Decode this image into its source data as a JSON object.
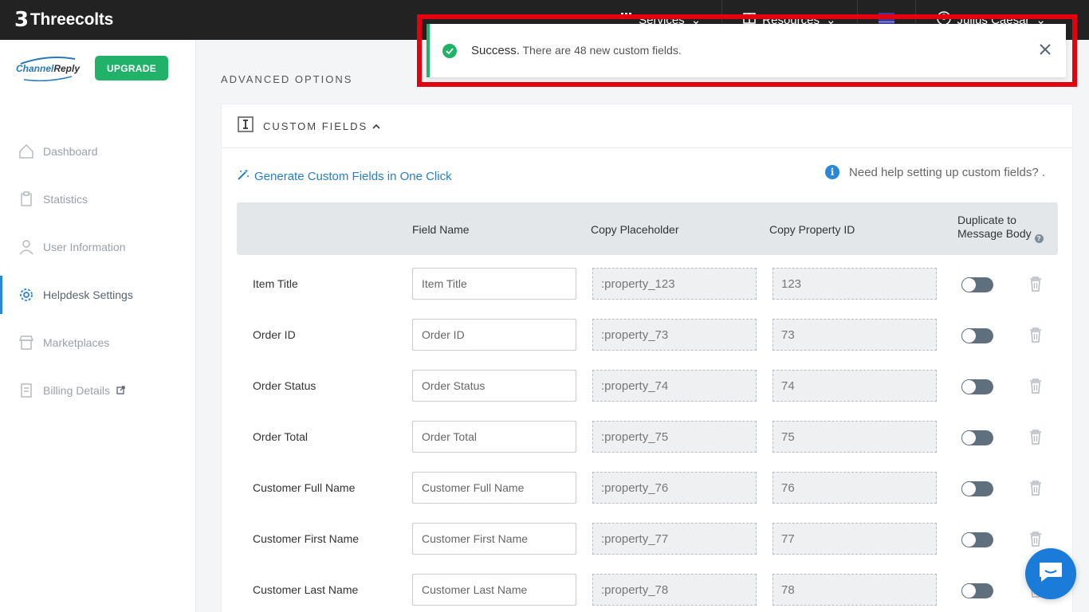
{
  "topbar": {
    "brand": "Threecolts",
    "nav": [
      {
        "label": "Services",
        "icon": "grid-icon"
      },
      {
        "label": "Resources",
        "icon": "book-icon"
      },
      {
        "label": "",
        "icon": "flag-icon"
      },
      {
        "label": "Julius Caesar",
        "icon": "user-icon"
      }
    ]
  },
  "sidebar": {
    "logo_text_a": "Channel",
    "logo_text_b": "Reply",
    "upgrade_label": "UPGRADE",
    "items": [
      {
        "label": "Dashboard",
        "icon": "home-icon"
      },
      {
        "label": "Statistics",
        "icon": "clipboard-icon"
      },
      {
        "label": "User Information",
        "icon": "user-icon"
      },
      {
        "label": "Helpdesk Settings",
        "icon": "gear-icon",
        "active": true
      },
      {
        "label": "Marketplaces",
        "icon": "store-icon"
      },
      {
        "label": "Billing Details",
        "icon": "receipt-icon"
      }
    ]
  },
  "main": {
    "section_title": "ADVANCED OPTIONS",
    "panel_title": "CUSTOM FIELDS",
    "generate_link": "Generate Custom Fields in One Click",
    "help_text": "Need help setting up custom fields? .",
    "columns": {
      "field_name": "Field Name",
      "copy_placeholder": "Copy Placeholder",
      "copy_property_id": "Copy Property ID",
      "duplicate_line1": "Duplicate to",
      "duplicate_line2": "Message Body"
    },
    "rows": [
      {
        "label": "Item Title",
        "field": "Item Title",
        "placeholder": ":property_123",
        "property_id": "123"
      },
      {
        "label": "Order ID",
        "field": "Order ID",
        "placeholder": ":property_73",
        "property_id": "73"
      },
      {
        "label": "Order Status",
        "field": "Order Status",
        "placeholder": ":property_74",
        "property_id": "74"
      },
      {
        "label": "Order Total",
        "field": "Order Total",
        "placeholder": ":property_75",
        "property_id": "75"
      },
      {
        "label": "Customer Full Name",
        "field": "Customer Full Name",
        "placeholder": ":property_76",
        "property_id": "76"
      },
      {
        "label": "Customer First Name",
        "field": "Customer First Name",
        "placeholder": ":property_77",
        "property_id": "77"
      },
      {
        "label": "Customer Last Name",
        "field": "Customer Last Name",
        "placeholder": ":property_78",
        "property_id": "78"
      }
    ]
  },
  "toast": {
    "title": "Success.",
    "message": "There are 48 new custom fields."
  },
  "colors": {
    "accent_green": "#21b26a",
    "link_blue": "#2a7fc0",
    "highlight_red": "#e3000f"
  }
}
